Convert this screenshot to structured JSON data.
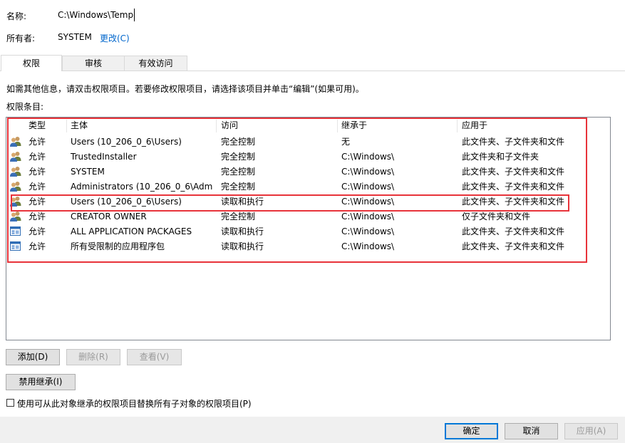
{
  "header": {
    "name_label": "名称:",
    "name_value": "C:\\Windows\\Temp",
    "owner_label": "所有者:",
    "owner_value": "SYSTEM",
    "change_link": "更改(C)"
  },
  "tabs": [
    {
      "label": "权限",
      "active": true
    },
    {
      "label": "审核",
      "active": false
    },
    {
      "label": "有效访问",
      "active": false
    }
  ],
  "info_text": "如需其他信息，请双击权限项目。若要修改权限项目，请选择该项目并单击“编辑”(如果可用)。",
  "entries_label": "权限条目:",
  "table": {
    "columns": [
      "类型",
      "主体",
      "访问",
      "继承于",
      "应用于"
    ],
    "rows": [
      {
        "icon": "user-group-icon",
        "type": "允许",
        "principal": "Users (10_206_0_6\\Users)",
        "access": "完全控制",
        "inherited": "无",
        "applies": "此文件夹、子文件夹和文件"
      },
      {
        "icon": "user-group-icon",
        "type": "允许",
        "principal": "TrustedInstaller",
        "access": "完全控制",
        "inherited": "C:\\Windows\\",
        "applies": "此文件夹和子文件夹"
      },
      {
        "icon": "user-group-icon",
        "type": "允许",
        "principal": "SYSTEM",
        "access": "完全控制",
        "inherited": "C:\\Windows\\",
        "applies": "此文件夹、子文件夹和文件"
      },
      {
        "icon": "user-group-icon",
        "type": "允许",
        "principal": "Administrators (10_206_0_6\\Adm...",
        "access": "完全控制",
        "inherited": "C:\\Windows\\",
        "applies": "此文件夹、子文件夹和文件"
      },
      {
        "icon": "user-group-icon",
        "type": "允许",
        "principal": "Users (10_206_0_6\\Users)",
        "access": "读取和执行",
        "inherited": "C:\\Windows\\",
        "applies": "此文件夹、子文件夹和文件"
      },
      {
        "icon": "user-group-icon",
        "type": "允许",
        "principal": "CREATOR OWNER",
        "access": "完全控制",
        "inherited": "C:\\Windows\\",
        "applies": "仅子文件夹和文件"
      },
      {
        "icon": "app-package-icon",
        "type": "允许",
        "principal": "ALL APPLICATION PACKAGES",
        "access": "读取和执行",
        "inherited": "C:\\Windows\\",
        "applies": "此文件夹、子文件夹和文件"
      },
      {
        "icon": "app-package-icon",
        "type": "允许",
        "principal": "所有受限制的应用程序包",
        "access": "读取和执行",
        "inherited": "C:\\Windows\\",
        "applies": "此文件夹、子文件夹和文件"
      }
    ]
  },
  "buttons": {
    "add": "添加(D)",
    "remove": "删除(R)",
    "view": "查看(V)",
    "disable_inheritance": "禁用继承(I)"
  },
  "replace_checkbox_label": "使用可从此对象继承的权限项目替换所有子对象的权限项目(P)",
  "footer": {
    "ok": "确定",
    "cancel": "取消",
    "apply": "应用(A)"
  },
  "colors": {
    "highlight_box": "#e8333a",
    "link": "#0066cc",
    "default_button_border": "#0078d7"
  }
}
